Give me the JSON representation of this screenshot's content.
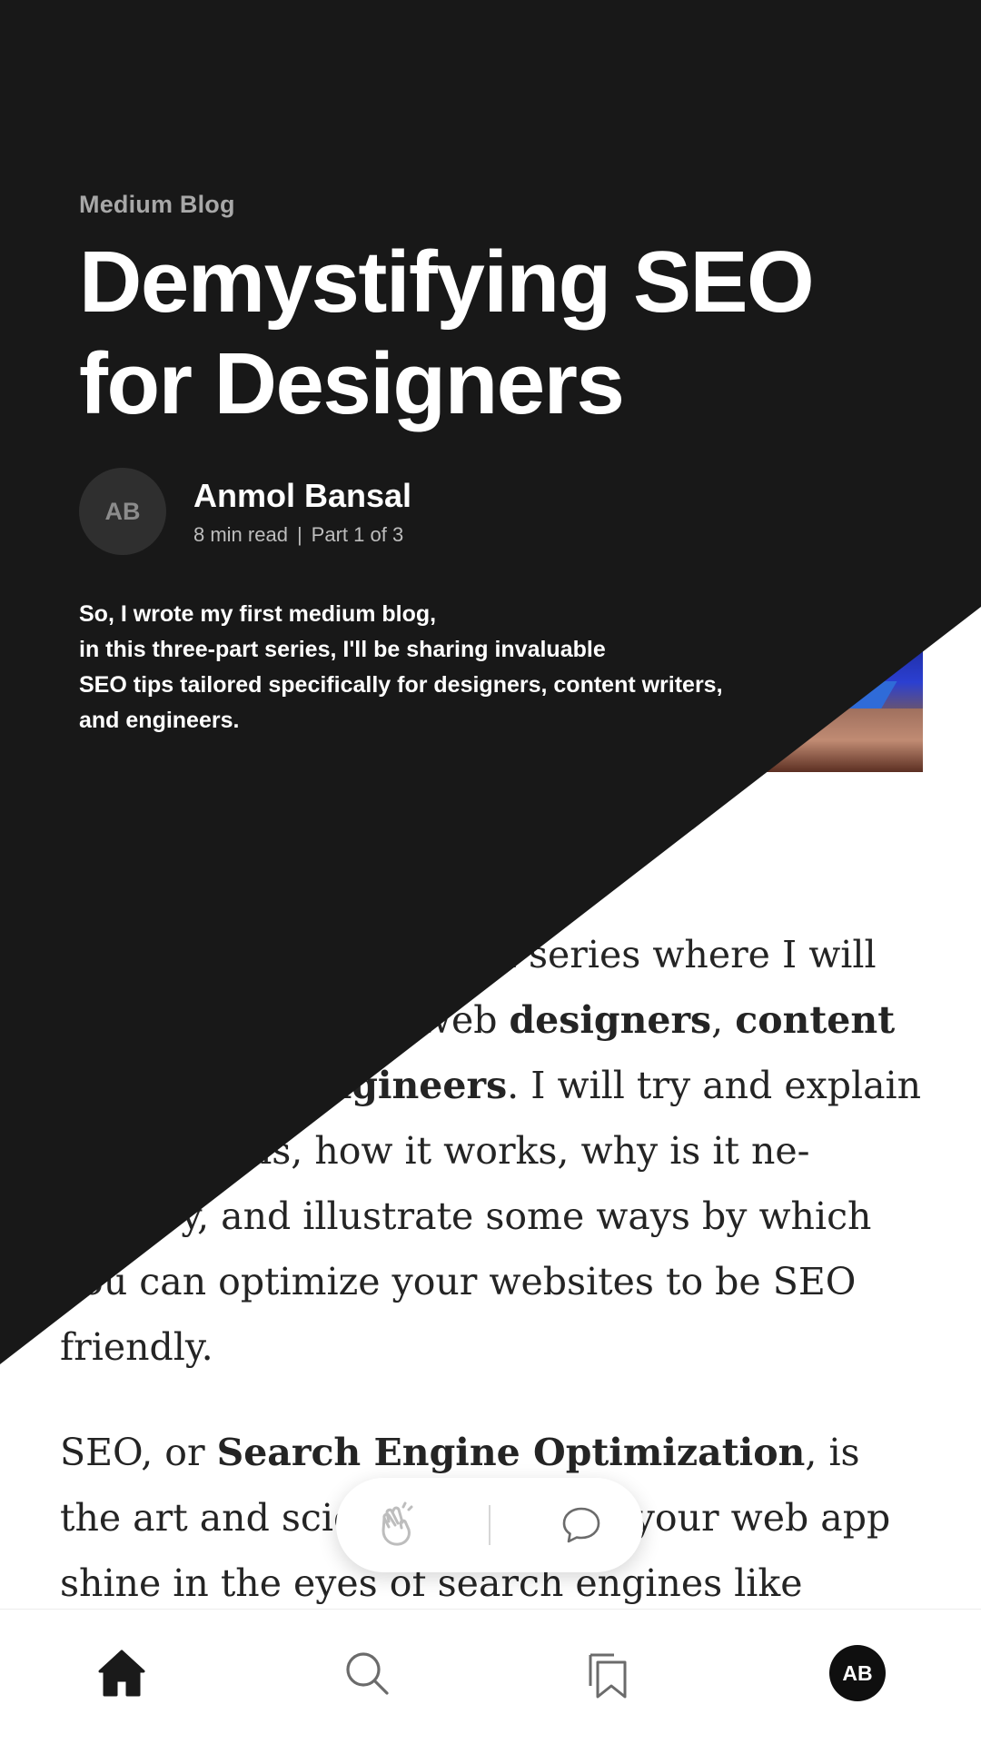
{
  "header": {
    "publication": "Medium Blog",
    "title_line1": "Demystifying SEO",
    "title_line2": "for Designers",
    "author": {
      "initials": "AB",
      "name": "Anmol Bansal",
      "read_time": "8 min read",
      "separator": "|",
      "part": "Part 1 of 3"
    },
    "intro_lines": [
      "So, I wrote my first medium blog,",
      "in this three-part series, I'll be sharing invaluable",
      "SEO tips tailored specifically for designers, content writers,",
      "and engineers."
    ]
  },
  "article": {
    "p1": {
      "t1": "This is the first part of a series where I will share SEO tips for web ",
      "b1": "designers",
      "t2": ", ",
      "b2": "content writers",
      "t3": " and ",
      "b3": "engineers",
      "t4": ". I will try and explain what SEO is, how it works, why is it ne-cessary, and illustrate some ways by which you can optimize your websites to be SEO friendly."
    },
    "p2": {
      "t1": "SEO, or ",
      "b1": "Search Engine Optimization",
      "t2": ", is the art and science of making your web app shine in the eyes of search engines like Google. It’s like the secret sauce that helps your website rank"
    }
  },
  "reactions": {
    "clap_icon": "clap-icon",
    "comment_icon": "comment-icon"
  },
  "nav": {
    "items": [
      {
        "icon": "home-icon"
      },
      {
        "icon": "search-icon"
      },
      {
        "icon": "bookmarks-icon"
      },
      {
        "icon": "profile-avatar",
        "initials": "AB"
      }
    ]
  },
  "colors": {
    "overlay": "#181818",
    "text_dark": "#242424",
    "eyebrow": "#a8a8a8"
  }
}
